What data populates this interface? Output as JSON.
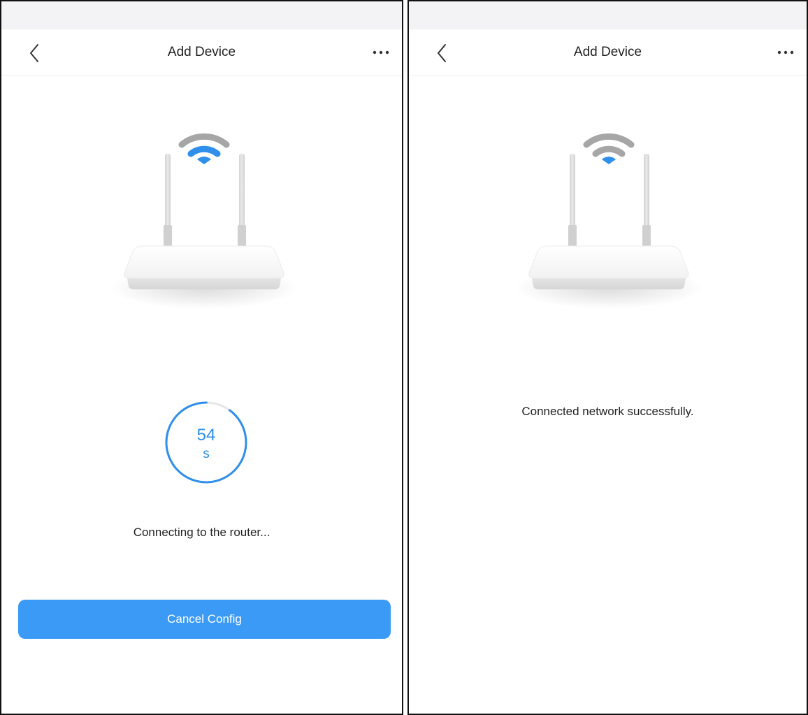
{
  "colors": {
    "accent": "#3a9af5",
    "wifi_active": "#2f8fea",
    "wifi_inactive": "#a6a6a6",
    "border": "#111111"
  },
  "left_screen": {
    "header": {
      "title": "Add Device",
      "back_icon": "chevron-left-icon",
      "more_icon": "more-dots-icon"
    },
    "illustration": {
      "icon": "router-icon",
      "wifi_icon": "wifi-icon",
      "wifi_arcs_active": 2
    },
    "countdown": {
      "value": "54",
      "unit": "s",
      "progress": 0.9
    },
    "status_text": "Connecting to the router...",
    "cancel_button": "Cancel Config"
  },
  "right_screen": {
    "header": {
      "title": "Add Device",
      "back_icon": "chevron-left-icon",
      "more_icon": "more-dots-icon"
    },
    "illustration": {
      "icon": "router-icon",
      "wifi_icon": "wifi-icon",
      "wifi_arcs_active": 1
    },
    "status_text": "Connected network successfully."
  }
}
